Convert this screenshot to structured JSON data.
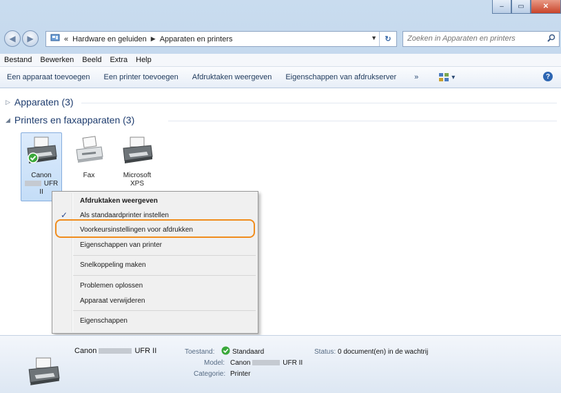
{
  "window": {
    "caption_buttons": {
      "minimize": "–",
      "maximize": "▭",
      "close": "✕"
    }
  },
  "nav": {
    "back": "◀",
    "forward": "▶",
    "breadcrumb_prefix": "«",
    "breadcrumb": [
      "Hardware en geluiden",
      "Apparaten en printers"
    ],
    "refresh": "↻",
    "search_placeholder": "Zoeken in Apparaten en printers"
  },
  "menubar": [
    "Bestand",
    "Bewerken",
    "Beeld",
    "Extra",
    "Help"
  ],
  "commandbar": {
    "items": [
      "Een apparaat toevoegen",
      "Een printer toevoegen",
      "Afdruktaken weergeven",
      "Eigenschappen van afdrukserver"
    ],
    "more": "»",
    "view_dropdown": "▾",
    "help": "?"
  },
  "groups": [
    {
      "label": "Apparaten (3)",
      "expanded": false
    },
    {
      "label": "Printers en faxapparaten (3)",
      "expanded": true
    }
  ],
  "devices": [
    {
      "line1": "Canon",
      "line2": "UFR",
      "line3": "II",
      "selected": true
    },
    {
      "line1": "Fax",
      "line2": "",
      "line3": "",
      "selected": false
    },
    {
      "line1": "Microsoft",
      "line2": "XPS",
      "line3": "",
      "selected": false
    }
  ],
  "context_menu": {
    "items": [
      "Afdruktaken weergeven",
      "Als standaardprinter instellen",
      "Voorkeursinstellingen voor afdrukken",
      "Eigenschappen van printer",
      "Snelkoppeling maken",
      "Problemen oplossen",
      "Apparaat verwijderen",
      "Eigenschappen"
    ],
    "checked_item": "Als standaardprinter instellen",
    "highlighted_item": "Voorkeursinstellingen voor afdrukken",
    "check": "✓"
  },
  "details": {
    "name_prefix": "Canon",
    "name_suffix": "UFR II",
    "state_label": "Toestand:",
    "state_value": "Standaard",
    "model_label": "Model:",
    "model_prefix": "Canon",
    "model_suffix": "UFR II",
    "category_label": "Categorie:",
    "category_value": "Printer",
    "status_label": "Status:",
    "status_value": "0 document(en) in de wachtrij"
  },
  "colors": {
    "highlight_outline": "#f08c1c",
    "accent": "#2d66b2"
  }
}
